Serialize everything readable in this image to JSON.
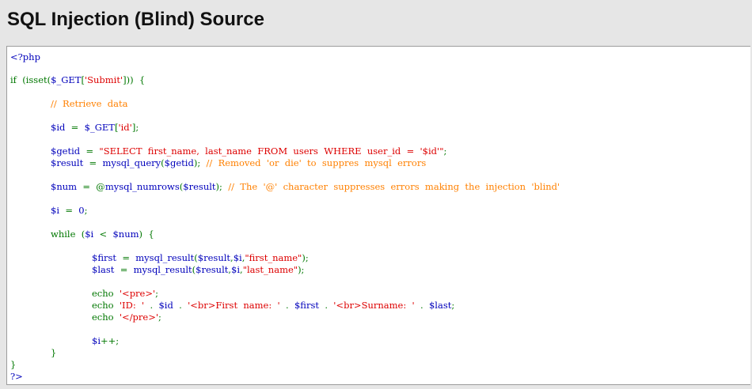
{
  "page": {
    "title": "SQL Injection (Blind) Source"
  },
  "code": {
    "lines": [
      {
        "indent": 0,
        "parts": [
          {
            "t": "php",
            "text": "<?php"
          }
        ]
      },
      {
        "indent": 0,
        "parts": [
          {
            "t": "kw",
            "text": "if  (isset("
          },
          {
            "t": "php",
            "text": "$_GET"
          },
          {
            "t": "kw",
            "text": "["
          },
          {
            "t": "str",
            "text": "'Submit'"
          },
          {
            "t": "kw",
            "text": "]))  {"
          }
        ]
      },
      {
        "indent": 1,
        "parts": [
          {
            "t": "cmt",
            "text": "//  Retrieve  data"
          }
        ]
      },
      {
        "indent": 1,
        "parts": [
          {
            "t": "php",
            "text": "$id  "
          },
          {
            "t": "kw",
            "text": "=  "
          },
          {
            "t": "php",
            "text": "$_GET"
          },
          {
            "t": "kw",
            "text": "["
          },
          {
            "t": "str",
            "text": "'id'"
          },
          {
            "t": "kw",
            "text": "];"
          }
        ]
      },
      {
        "indent": 1,
        "parts": [
          {
            "t": "php",
            "text": "$getid  "
          },
          {
            "t": "kw",
            "text": "=  "
          },
          {
            "t": "str",
            "text": "\"SELECT  first_name,  last_name  FROM  users  WHERE  user_id  =  '$id'\""
          },
          {
            "t": "kw",
            "text": ";"
          }
        ]
      },
      {
        "indent": 1,
        "parts": [
          {
            "t": "php",
            "text": "$result  "
          },
          {
            "t": "kw",
            "text": "=  "
          },
          {
            "t": "php",
            "text": "mysql_query"
          },
          {
            "t": "kw",
            "text": "("
          },
          {
            "t": "php",
            "text": "$getid"
          },
          {
            "t": "kw",
            "text": ");  "
          },
          {
            "t": "cmt",
            "text": "//  Removed  'or  die'  to  suppres  mysql  errors"
          }
        ]
      },
      {
        "indent": 1,
        "parts": [
          {
            "t": "php",
            "text": "$num  "
          },
          {
            "t": "kw",
            "text": "=  @"
          },
          {
            "t": "php",
            "text": "mysql_numrows"
          },
          {
            "t": "kw",
            "text": "("
          },
          {
            "t": "php",
            "text": "$result"
          },
          {
            "t": "kw",
            "text": ");  "
          },
          {
            "t": "cmt",
            "text": "//  The  '@'  character  suppresses  errors  making  the  injection  'blind'"
          }
        ]
      },
      {
        "indent": 1,
        "parts": [
          {
            "t": "php",
            "text": "$i  "
          },
          {
            "t": "kw",
            "text": "=  "
          },
          {
            "t": "php",
            "text": "0"
          },
          {
            "t": "kw",
            "text": ";"
          }
        ]
      },
      {
        "indent": 1,
        "parts": [
          {
            "t": "kw",
            "text": "while  ("
          },
          {
            "t": "php",
            "text": "$i  "
          },
          {
            "t": "kw",
            "text": "<  "
          },
          {
            "t": "php",
            "text": "$num"
          },
          {
            "t": "kw",
            "text": ")  {"
          }
        ]
      },
      {
        "indent": 2,
        "parts": [
          {
            "t": "php",
            "text": "$first  "
          },
          {
            "t": "kw",
            "text": "=  "
          },
          {
            "t": "php",
            "text": "mysql_result"
          },
          {
            "t": "kw",
            "text": "("
          },
          {
            "t": "php",
            "text": "$result"
          },
          {
            "t": "kw",
            "text": ","
          },
          {
            "t": "php",
            "text": "$i"
          },
          {
            "t": "kw",
            "text": ","
          },
          {
            "t": "str",
            "text": "\"first_name\""
          },
          {
            "t": "kw",
            "text": ");"
          }
        ]
      },
      {
        "indent": 2,
        "parts": [
          {
            "t": "php",
            "text": "$last  "
          },
          {
            "t": "kw",
            "text": "=  "
          },
          {
            "t": "php",
            "text": "mysql_result"
          },
          {
            "t": "kw",
            "text": "("
          },
          {
            "t": "php",
            "text": "$result"
          },
          {
            "t": "kw",
            "text": ","
          },
          {
            "t": "php",
            "text": "$i"
          },
          {
            "t": "kw",
            "text": ","
          },
          {
            "t": "str",
            "text": "\"last_name\""
          },
          {
            "t": "kw",
            "text": ");"
          }
        ]
      },
      {
        "indent": 2,
        "parts": [
          {
            "t": "kw",
            "text": "echo  "
          },
          {
            "t": "str",
            "text": "'<pre>'"
          },
          {
            "t": "kw",
            "text": ";"
          }
        ]
      },
      {
        "indent": 2,
        "parts": [
          {
            "t": "kw",
            "text": "echo  "
          },
          {
            "t": "str",
            "text": "'ID:  '  "
          },
          {
            "t": "kw",
            "text": ".  "
          },
          {
            "t": "php",
            "text": "$id  "
          },
          {
            "t": "kw",
            "text": ".  "
          },
          {
            "t": "str",
            "text": "'<br>First  name:  '  "
          },
          {
            "t": "kw",
            "text": ".  "
          },
          {
            "t": "php",
            "text": "$first  "
          },
          {
            "t": "kw",
            "text": ".  "
          },
          {
            "t": "str",
            "text": "'<br>Surname:  '  "
          },
          {
            "t": "kw",
            "text": ".  "
          },
          {
            "t": "php",
            "text": "$last"
          },
          {
            "t": "kw",
            "text": ";"
          }
        ]
      },
      {
        "indent": 2,
        "parts": [
          {
            "t": "kw",
            "text": "echo  "
          },
          {
            "t": "str",
            "text": "'</pre>'"
          },
          {
            "t": "kw",
            "text": ";"
          }
        ]
      },
      {
        "indent": 2,
        "parts": [
          {
            "t": "php",
            "text": "$i"
          },
          {
            "t": "kw",
            "text": "++;"
          }
        ]
      },
      {
        "indent": 1,
        "parts": [
          {
            "t": "kw",
            "text": "}"
          }
        ]
      },
      {
        "indent": 0,
        "parts": [
          {
            "t": "kw",
            "text": "}"
          }
        ]
      },
      {
        "indent": 0,
        "parts": [
          {
            "t": "php",
            "text": "?>"
          }
        ]
      }
    ]
  }
}
